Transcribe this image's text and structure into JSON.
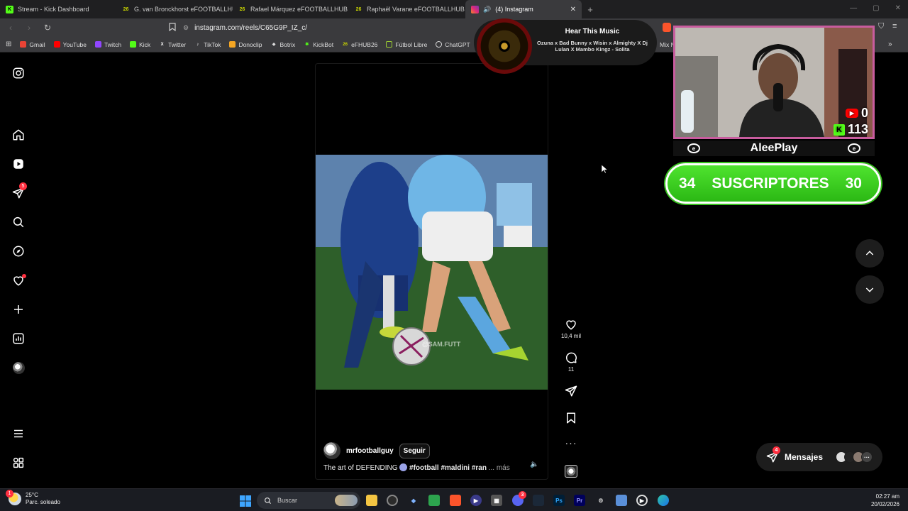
{
  "browser": {
    "tabs": [
      {
        "title": "Stream - Kick Dashboard",
        "icon": "kick-icon",
        "color": "#53fc18"
      },
      {
        "title": "G. van Bronckhorst eFOOTBALLHUB",
        "icon": "efhub-icon",
        "color": "#c8d400"
      },
      {
        "title": "Rafael Márquez eFOOTBALLHUB Jug",
        "icon": "efhub-icon",
        "color": "#c8d400"
      },
      {
        "title": "Raphaël Varane eFOOTBALLHUB Jug",
        "icon": "efhub-icon",
        "color": "#c8d400"
      },
      {
        "title": "(4) Instagram",
        "icon": "instagram-icon",
        "color": "#e1306c",
        "active": true
      }
    ],
    "url": "instagram.com/reels/C65G9P_IZ_c/",
    "bookmarks": [
      {
        "label": "Gmail",
        "color": "#ea4335"
      },
      {
        "label": "YouTube",
        "color": "#ff0000"
      },
      {
        "label": "Twitch",
        "color": "#9146ff"
      },
      {
        "label": "Kick",
        "color": "#53fc18"
      },
      {
        "label": "Twitter",
        "color": "#ffffff"
      },
      {
        "label": "TikTok",
        "color": "#ffffff"
      },
      {
        "label": "Donoclip",
        "color": "#f5a623"
      },
      {
        "label": "Botrix",
        "color": "#dddddd"
      },
      {
        "label": "KickBot",
        "color": "#53fc18"
      },
      {
        "label": "eFHUB26",
        "color": "#c8d400"
      },
      {
        "label": "Fútbol Libre",
        "color": "#9acd32"
      },
      {
        "label": "ChatGPT",
        "color": "#dddddd"
      }
    ],
    "bookmark_overflow": "Mix N"
  },
  "instagram": {
    "sidebar": {
      "notifications_badge": "5"
    },
    "reel": {
      "username": "mrfootballguy",
      "follow_label": "Seguir",
      "caption_prefix": "The art of DEFENDING",
      "caption_tags": "#football #maldini #ran",
      "caption_more": "... más",
      "watermark": "@SAM.FUTT",
      "likes": "10,4 mil",
      "comments": "11"
    },
    "messages": {
      "label": "Mensajes",
      "badge": "4"
    }
  },
  "now_playing": {
    "title": "Hear This Music",
    "track": "Ozuna x Bad Bunny x Wisin x Almighty X Dj Lulan X Mambo Kingz - Solita"
  },
  "stream_overlay": {
    "youtube_count": "0",
    "kick_count": "113",
    "streamer": "AleePlay",
    "subs_left": "34",
    "subs_label": "SUSCRIPTORES",
    "subs_right": "30"
  },
  "taskbar": {
    "weather_temp": "25°C",
    "weather_desc": "Parc. soleado",
    "weather_badge": "1",
    "search_placeholder": "Buscar",
    "discord_badge": "3",
    "time": "02:27 am",
    "date": "20/02/2026"
  }
}
